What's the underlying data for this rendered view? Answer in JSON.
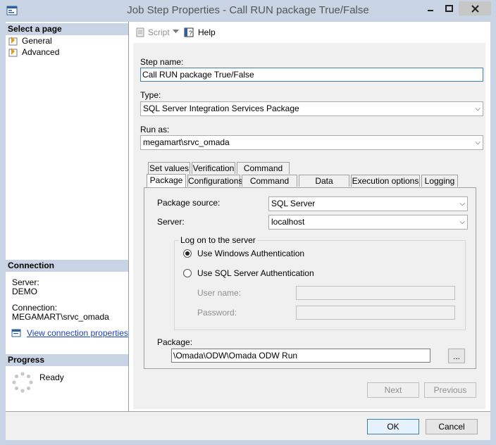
{
  "window": {
    "title": "Job Step Properties - Call RUN package True/False"
  },
  "left_pane": {
    "select_page_header": "Select a page",
    "pages": [
      {
        "label": "General"
      },
      {
        "label": "Advanced"
      }
    ],
    "connection_header": "Connection",
    "server_label": "Server:",
    "server_value": "DEMO",
    "connection_label": "Connection:",
    "connection_value": "MEGAMART\\srvc_omada",
    "view_connection_link": "View connection properties",
    "progress_header": "Progress",
    "progress_status": "Ready"
  },
  "toolbar": {
    "script_label": "Script",
    "help_label": "Help"
  },
  "form": {
    "step_name_label": "Step name:",
    "step_name_value": "Call RUN package True/False",
    "type_label": "Type:",
    "type_value": "SQL Server Integration Services Package",
    "run_as_label": "Run as:",
    "run_as_value": "megamart\\srvc_omada"
  },
  "tabs_row1": [
    "Set values",
    "Verification",
    "Command line"
  ],
  "tabs_row2": [
    "Package",
    "Configurations",
    "Command files",
    "Data sources",
    "Execution options",
    "Logging"
  ],
  "package_tab": {
    "source_label": "Package source:",
    "source_value": "SQL Server",
    "server_label": "Server:",
    "server_value": "localhost",
    "logon_group_title": "Log on to the server",
    "windows_auth": "Use Windows Authentication",
    "sql_auth": "Use SQL Server Authentication",
    "username_label": "User name:",
    "password_label": "Password:",
    "package_label": "Package:",
    "package_value": "\\Omada\\ODW\\Omada ODW Run",
    "browse_label": "..."
  },
  "nav_buttons": {
    "next": "Next",
    "previous": "Previous"
  },
  "footer": {
    "ok": "OK",
    "cancel": "Cancel"
  }
}
